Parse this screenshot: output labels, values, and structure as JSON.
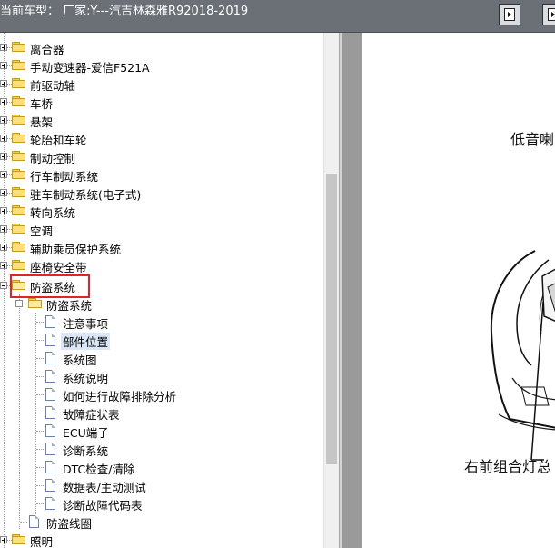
{
  "header": {
    "title": "当前车型： 厂家:Y---汽吉林森雅R92018-2019"
  },
  "tree": {
    "top_items": [
      "离合器",
      "手动变速器-爱信F521A",
      "前驱动轴",
      "车桥",
      "悬架",
      "轮胎和车轮",
      "制动控制",
      "行车制动系统",
      "驻车制动系统(电子式)",
      "转向系统",
      "空调",
      "辅助乘员保护系统",
      "座椅安全带",
      "防盗系统"
    ],
    "sub_folder": "防盗系统",
    "documents": [
      "注意事项",
      "部件位置",
      "系统图",
      "系统说明",
      "如何进行故障排除分析",
      "故障症状表",
      "ECU端子",
      "诊断系统",
      "DTC检查/清除",
      "数据表/主动测试",
      "诊断故障代码表"
    ],
    "selected_document": "部件位置",
    "sub_folder_2": "防盗线圈",
    "last_item": "照明"
  },
  "document": {
    "label_top": "低音喇",
    "label_bottom": "右前组合灯总"
  },
  "colors": {
    "highlight_box": "#e0242b",
    "selection": "#dbe7f7",
    "topbar": "#6b7077"
  }
}
